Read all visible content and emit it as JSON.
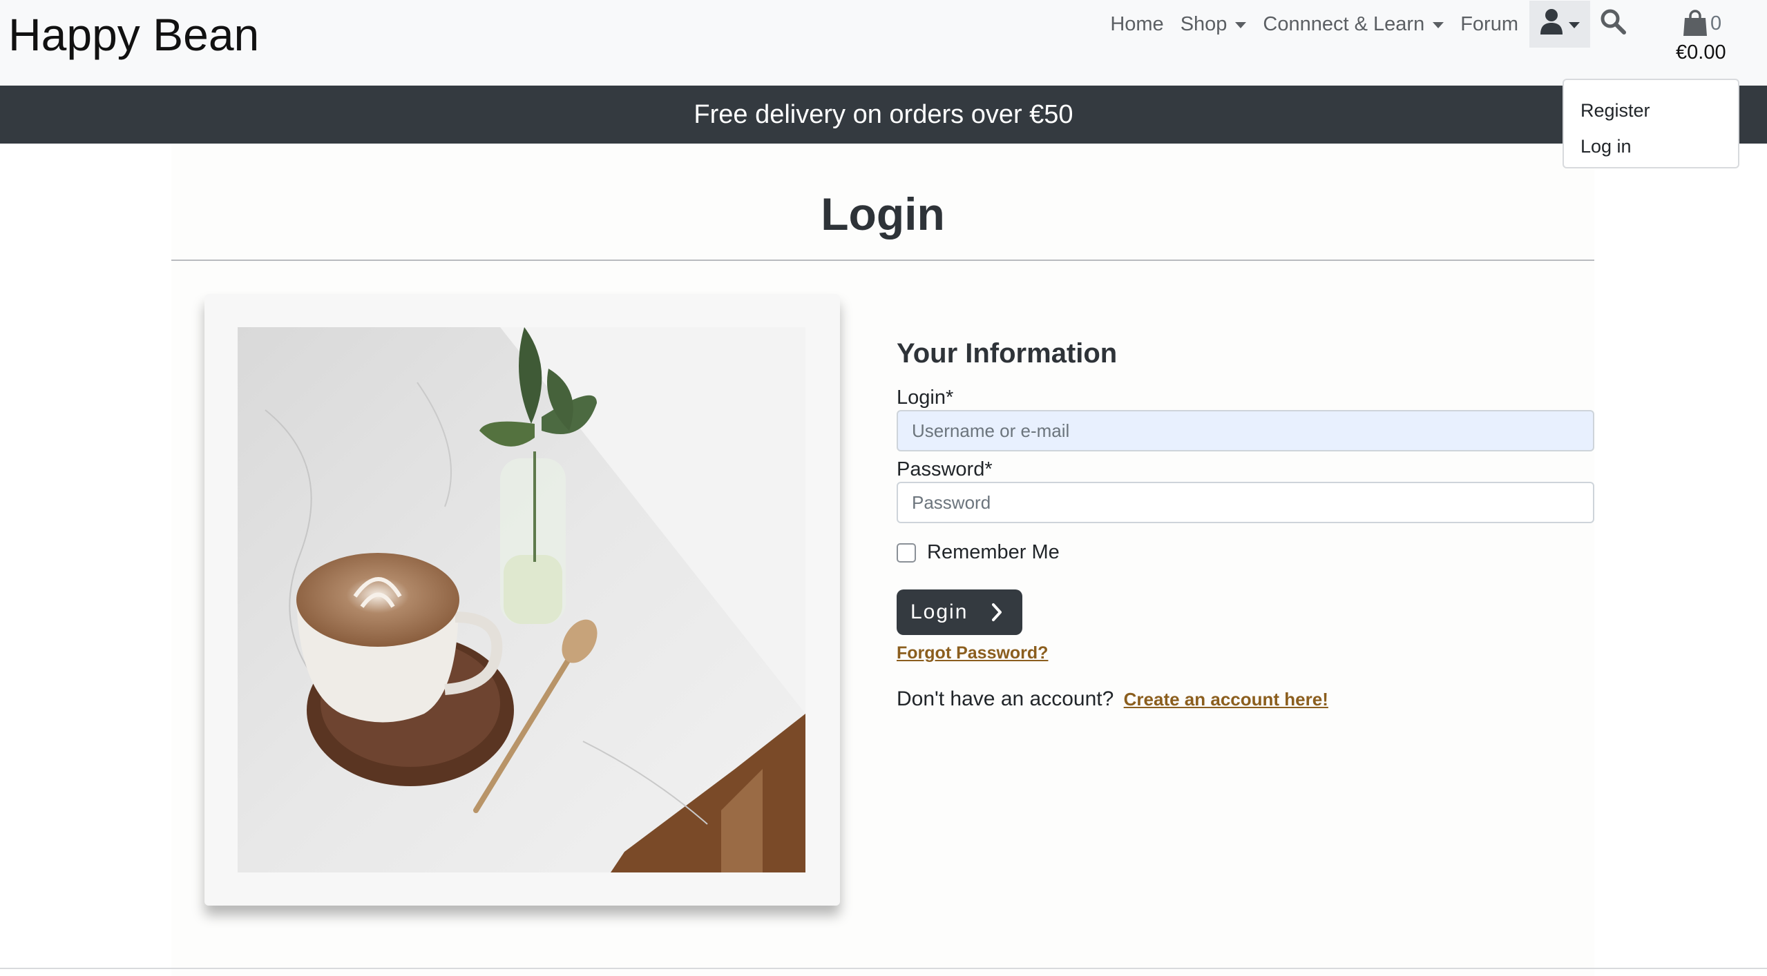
{
  "brand": "Happy Bean",
  "nav": {
    "home": "Home",
    "shop": "Shop",
    "connect": "Connnect & Learn",
    "forum": "Forum",
    "bag_count": "0",
    "bag_total": "€0.00"
  },
  "account_menu": {
    "items": [
      "Register",
      "Log in"
    ]
  },
  "banner": "Free delivery on orders over €50",
  "page_title": "Login",
  "form": {
    "section_title": "Your Information",
    "login_label": "Login*",
    "login_placeholder": "Username or e-mail",
    "password_label": "Password*",
    "password_placeholder": "Password",
    "remember_label": "Remember Me",
    "remember_checked": false,
    "submit_label": "Login",
    "forgot_link": "Forgot Password?",
    "no_account_text": "Don't have an account?",
    "create_link": "Create an account here!"
  },
  "colors": {
    "navbar_bg": "#f8f9fa",
    "banner_bg": "#343a40",
    "button_bg": "#343a40",
    "link": "#8b5e1e",
    "autofill_bg": "#e8f0fe"
  },
  "icons": [
    "user-icon",
    "search-icon",
    "shopping-bag-icon",
    "chevron-right-icon"
  ]
}
